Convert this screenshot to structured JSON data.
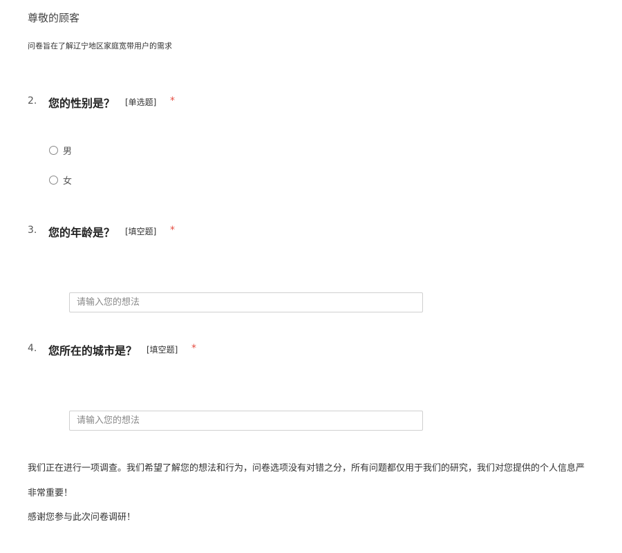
{
  "header": {
    "greeting": "尊敬的顾客",
    "intro": "问卷旨在了解辽宁地区家庭宽带用户的需求"
  },
  "questions": [
    {
      "number": "2.",
      "title": "您的性别是？",
      "type": "[单选题]",
      "required": "*",
      "options": [
        "男",
        "女"
      ]
    },
    {
      "number": "3.",
      "title": "您的年龄是？",
      "type": "[填空题]",
      "required": "*",
      "placeholder": "请输入您的想法"
    },
    {
      "number": "4.",
      "title": "您所在的城市是？",
      "type": "[填空题]",
      "required": "*",
      "placeholder": "请输入您的想法"
    }
  ],
  "footer": {
    "line1": "我们正在进行一项调查。我们希望了解您的想法和行为，问卷选项没有对错之分，所有问题都仅用于我们的研究，我们对您提供的个人信息严",
    "line2": "非常重要！",
    "line3": "感谢您参与此次问卷调研！"
  }
}
